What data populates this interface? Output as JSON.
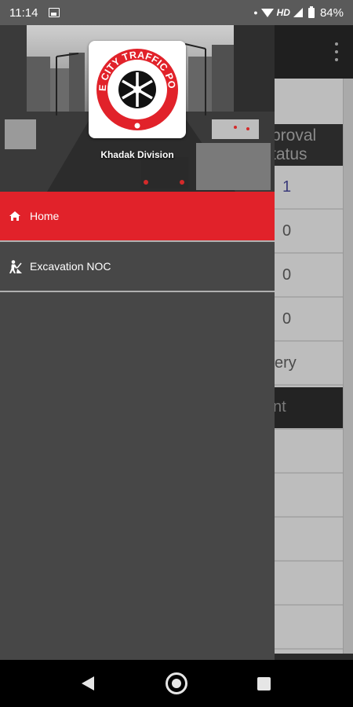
{
  "status_bar": {
    "time": "11:14",
    "network": "HD",
    "battery": "84%",
    "icons": [
      "image-icon",
      "dot-icon",
      "wifi-icon",
      "signal-icon",
      "battery-icon"
    ]
  },
  "drawer": {
    "division": "Khadak Division",
    "logo_text": "PUNE CITY TRAFFIC POLICE",
    "items": [
      {
        "label": "Home",
        "icon": "home-icon",
        "selected": true
      },
      {
        "label": "Excavation NOC",
        "icon": "excavation-icon",
        "selected": false
      }
    ]
  },
  "background_app": {
    "header_line1": "proval",
    "header_line2": "tatus",
    "rows": [
      "1",
      "0",
      "0",
      "0",
      "ery",
      "nt"
    ]
  },
  "colors": {
    "accent": "#e1222a",
    "drawer_bg": "#474747",
    "toolbar": "#1f1f1f"
  }
}
